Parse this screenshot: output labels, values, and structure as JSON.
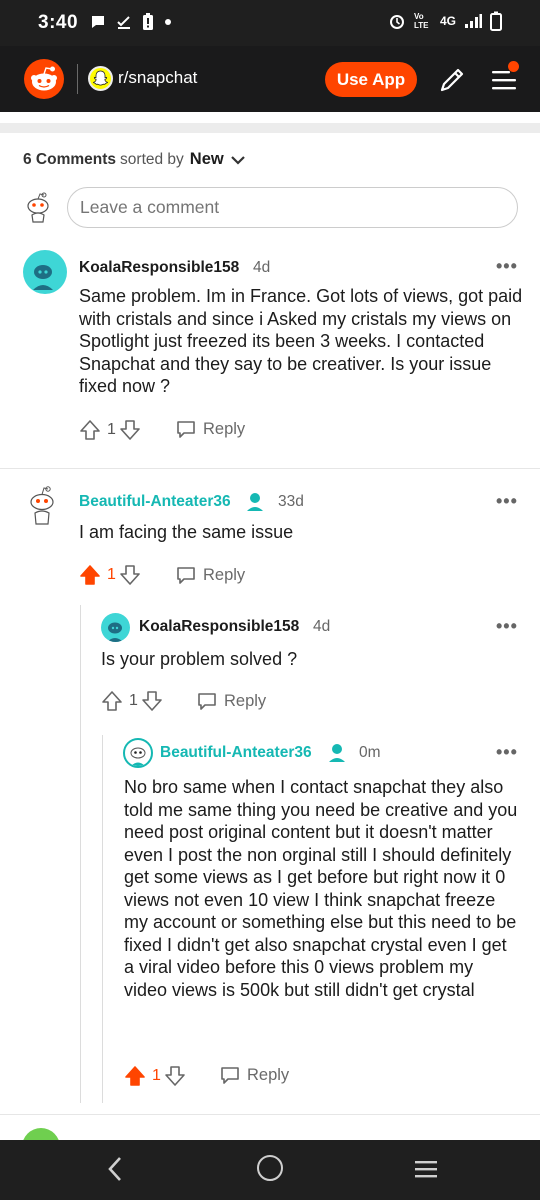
{
  "status_bar": {
    "time": "3:40",
    "network": "4G",
    "volte": "Vo LTE"
  },
  "header": {
    "subreddit": "r/snapchat",
    "use_app_label": "Use App"
  },
  "sort": {
    "count_label": "6 Comments",
    "sorted_by": "sorted by",
    "sort_value": "New"
  },
  "composer": {
    "placeholder": "Leave a comment"
  },
  "comments": [
    {
      "author": "KoalaResponsible158",
      "age": "4d",
      "body": "Same problem. Im in France. Got lots of views, got paid with cristals and since i Asked my cristals my views on Spotlight just freezed its been 3 weeks. I contacted Snapchat and they say to be creativer. Is your issue fixed now ?",
      "votes": "1",
      "reply_label": "Reply"
    },
    {
      "author": "Beautiful-Anteater36",
      "age": "33d",
      "body": "I am facing the same issue",
      "votes": "1",
      "reply_label": "Reply"
    },
    {
      "author": "KoalaResponsible158",
      "age": "4d",
      "body": "Is your problem solved ?",
      "votes": "1",
      "reply_label": "Reply"
    },
    {
      "author": "Beautiful-Anteater36",
      "age": "0m",
      "body": "No bro same when I contact snapchat they also told me same thing you need be creative and you need post original content but it doesn't matter even I post the non orginal still I should definitely get some views as I get before but right now it 0 views not even 10 view I think snapchat freeze my account or something else but this need to be fixed I didn't get also snapchat crystal even I get a viral video before this 0 views problem my video views is 500k but still didn't get crystal",
      "votes": "1",
      "reply_label": "Reply"
    }
  ],
  "colors": {
    "brand": "#ff4500",
    "op_teal": "#15b8b3",
    "header_bg": "#1a1a1b"
  }
}
